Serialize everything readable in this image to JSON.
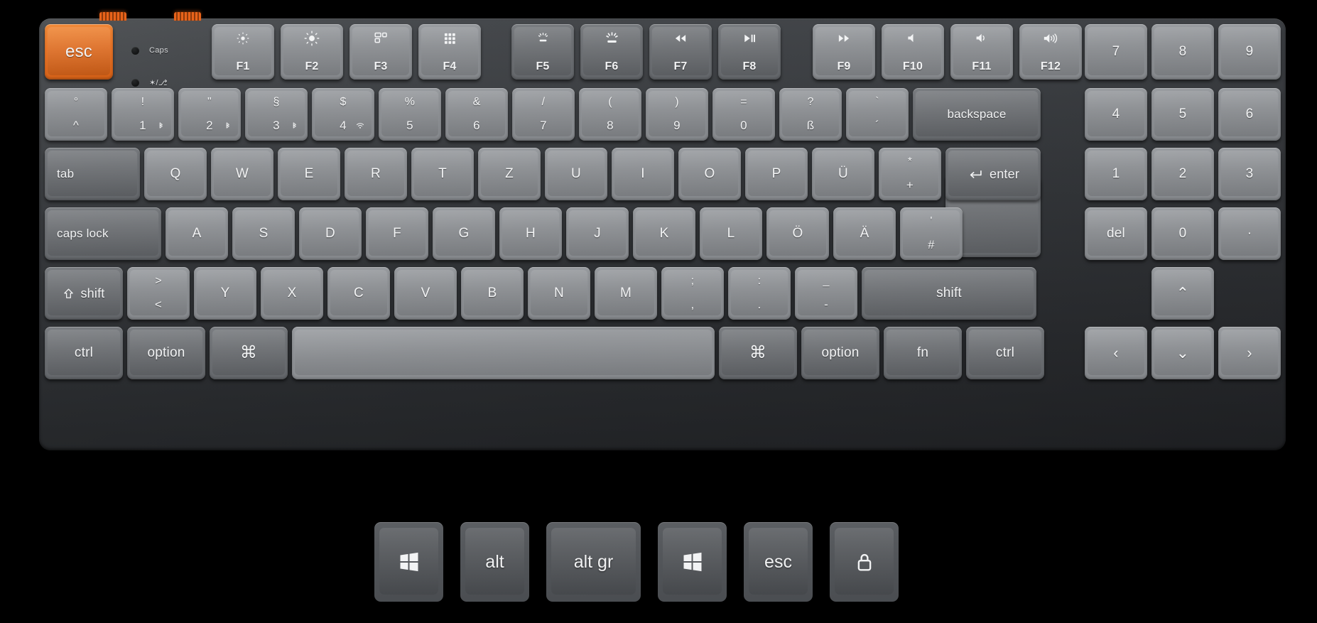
{
  "device": {
    "name": "keychron-low-profile-keyboard",
    "layout": "german-qwertz",
    "accent_color": "#e87428",
    "body_color": "#3d4044",
    "key_color_light": "#8e9195",
    "key_color_dark": "#6e7175",
    "legend_color": "#f2f3f4"
  },
  "indicators": [
    {
      "id": "caps-lock-indicator",
      "label": "Caps"
    },
    {
      "id": "bluetooth-wifi-indicator",
      "label": "✶/⎇"
    }
  ],
  "rows": {
    "function_row": [
      {
        "name": "escape",
        "label": "esc",
        "icon": "",
        "style": "esc"
      },
      {
        "name": "f1",
        "label": "F1",
        "icon": "brightness-down",
        "style": "light"
      },
      {
        "name": "f2",
        "label": "F2",
        "icon": "brightness-up",
        "style": "light"
      },
      {
        "name": "f3",
        "label": "F3",
        "icon": "mission-control",
        "style": "light"
      },
      {
        "name": "f4",
        "label": "F4",
        "icon": "launchpad",
        "style": "light"
      },
      {
        "name": "f5",
        "label": "F5",
        "icon": "backlight-down",
        "style": "dark"
      },
      {
        "name": "f6",
        "label": "F6",
        "icon": "backlight-up",
        "style": "dark"
      },
      {
        "name": "f7",
        "label": "F7",
        "icon": "rewind",
        "style": "dark"
      },
      {
        "name": "f8",
        "label": "F8",
        "icon": "play-pause",
        "style": "dark"
      },
      {
        "name": "f9",
        "label": "F9",
        "icon": "fast-forward",
        "style": "light"
      },
      {
        "name": "f10",
        "label": "F10",
        "icon": "mute",
        "style": "light"
      },
      {
        "name": "f11",
        "label": "F11",
        "icon": "volume-down",
        "style": "light"
      },
      {
        "name": "f12",
        "label": "F12",
        "icon": "volume-up",
        "style": "light"
      }
    ],
    "number_row": [
      {
        "name": "circumflex",
        "top": "°",
        "bottom": "^",
        "style": "light"
      },
      {
        "name": "digit-1",
        "top": "!",
        "bottom": "1",
        "style": "light",
        "badge": "bluetooth"
      },
      {
        "name": "digit-2",
        "top": "\"",
        "bottom": "2",
        "style": "light",
        "badge": "bluetooth"
      },
      {
        "name": "digit-3",
        "top": "§",
        "bottom": "3",
        "style": "light",
        "badge": "bluetooth"
      },
      {
        "name": "digit-4",
        "top": "$",
        "bottom": "4",
        "style": "light",
        "badge": "wifi"
      },
      {
        "name": "digit-5",
        "top": "%",
        "bottom": "5",
        "style": "light"
      },
      {
        "name": "digit-6",
        "top": "&",
        "bottom": "6",
        "style": "light"
      },
      {
        "name": "digit-7",
        "top": "/",
        "bottom": "7",
        "style": "light"
      },
      {
        "name": "digit-8",
        "top": "(",
        "bottom": "8",
        "style": "light"
      },
      {
        "name": "digit-9",
        "top": ")",
        "bottom": "9",
        "style": "light"
      },
      {
        "name": "digit-0",
        "top": "=",
        "bottom": "0",
        "style": "light"
      },
      {
        "name": "eszett",
        "top": "?",
        "bottom": "ß",
        "style": "light"
      },
      {
        "name": "acute",
        "top": "`",
        "bottom": "´",
        "style": "light"
      },
      {
        "name": "backspace",
        "label": "backspace",
        "style": "dark"
      }
    ],
    "top_row": [
      {
        "name": "tab",
        "label": "tab",
        "style": "dark",
        "align": "left"
      },
      {
        "name": "key-q",
        "label": "Q",
        "style": "light"
      },
      {
        "name": "key-w",
        "label": "W",
        "style": "light"
      },
      {
        "name": "key-e",
        "label": "E",
        "style": "light"
      },
      {
        "name": "key-r",
        "label": "R",
        "style": "light"
      },
      {
        "name": "key-t",
        "label": "T",
        "style": "light"
      },
      {
        "name": "key-z",
        "label": "Z",
        "style": "light"
      },
      {
        "name": "key-u",
        "label": "U",
        "style": "light"
      },
      {
        "name": "key-i",
        "label": "I",
        "style": "light"
      },
      {
        "name": "key-o",
        "label": "O",
        "style": "light"
      },
      {
        "name": "key-p",
        "label": "P",
        "style": "light"
      },
      {
        "name": "key-uuml",
        "label": "Ü",
        "style": "light"
      },
      {
        "name": "plus",
        "top": "*",
        "bottom": "+",
        "style": "light"
      },
      {
        "name": "enter",
        "label": "enter",
        "icon": "enter-arrow",
        "style": "dark"
      }
    ],
    "home_row": [
      {
        "name": "caps-lock",
        "label": "caps lock",
        "style": "dark",
        "align": "left"
      },
      {
        "name": "key-a",
        "label": "A",
        "style": "light"
      },
      {
        "name": "key-s",
        "label": "S",
        "style": "light"
      },
      {
        "name": "key-d",
        "label": "D",
        "style": "light"
      },
      {
        "name": "key-f",
        "label": "F",
        "style": "light"
      },
      {
        "name": "key-g",
        "label": "G",
        "style": "light"
      },
      {
        "name": "key-h",
        "label": "H",
        "style": "light"
      },
      {
        "name": "key-j",
        "label": "J",
        "style": "light"
      },
      {
        "name": "key-k",
        "label": "K",
        "style": "light"
      },
      {
        "name": "key-l",
        "label": "L",
        "style": "light"
      },
      {
        "name": "key-ouml",
        "label": "Ö",
        "style": "light"
      },
      {
        "name": "key-auml",
        "label": "Ä",
        "style": "light"
      },
      {
        "name": "hash",
        "top": "'",
        "bottom": "#",
        "style": "light"
      }
    ],
    "bottom_letter_row": [
      {
        "name": "left-shift",
        "label": "shift",
        "icon": "shift-arrow",
        "style": "dark"
      },
      {
        "name": "less-than",
        "top": ">",
        "bottom": "<",
        "style": "light"
      },
      {
        "name": "key-y",
        "label": "Y",
        "style": "light"
      },
      {
        "name": "key-x",
        "label": "X",
        "style": "light"
      },
      {
        "name": "key-c",
        "label": "C",
        "style": "light"
      },
      {
        "name": "key-v",
        "label": "V",
        "style": "light"
      },
      {
        "name": "key-b",
        "label": "B",
        "style": "light"
      },
      {
        "name": "key-n",
        "label": "N",
        "style": "light"
      },
      {
        "name": "key-m",
        "label": "M",
        "style": "light"
      },
      {
        "name": "semicolon",
        "top": ";",
        "bottom": ",",
        "style": "light"
      },
      {
        "name": "colon",
        "top": ":",
        "bottom": ".",
        "style": "light"
      },
      {
        "name": "dash",
        "top": "_",
        "bottom": "-",
        "style": "light"
      },
      {
        "name": "right-shift",
        "label": "shift",
        "style": "dark"
      }
    ],
    "modifier_row": [
      {
        "name": "left-ctrl",
        "label": "ctrl",
        "style": "dark"
      },
      {
        "name": "left-option",
        "label": "option",
        "style": "dark"
      },
      {
        "name": "left-command",
        "label": "⌘",
        "style": "dark"
      },
      {
        "name": "spacebar",
        "label": "",
        "style": "light"
      },
      {
        "name": "right-command",
        "label": "⌘",
        "style": "dark"
      },
      {
        "name": "right-option",
        "label": "option",
        "style": "dark"
      },
      {
        "name": "fn",
        "label": "fn",
        "style": "dark"
      },
      {
        "name": "right-ctrl",
        "label": "ctrl",
        "style": "dark"
      }
    ],
    "numpad": [
      {
        "name": "numpad-7",
        "label": "7",
        "style": "light"
      },
      {
        "name": "numpad-8",
        "label": "8",
        "style": "light"
      },
      {
        "name": "numpad-9",
        "label": "9",
        "style": "light"
      },
      {
        "name": "numpad-4",
        "label": "4",
        "style": "light"
      },
      {
        "name": "numpad-5",
        "label": "5",
        "style": "light"
      },
      {
        "name": "numpad-6",
        "label": "6",
        "style": "light"
      },
      {
        "name": "numpad-1",
        "label": "1",
        "style": "light"
      },
      {
        "name": "numpad-2",
        "label": "2",
        "style": "light"
      },
      {
        "name": "numpad-3",
        "label": "3",
        "style": "light"
      },
      {
        "name": "numpad-del",
        "label": "del",
        "style": "light"
      },
      {
        "name": "numpad-0",
        "label": "0",
        "style": "light"
      },
      {
        "name": "numpad-dot",
        "label": "·",
        "style": "light"
      }
    ],
    "arrows": [
      {
        "name": "arrow-up",
        "label": "⌃",
        "style": "light"
      },
      {
        "name": "arrow-left",
        "label": "‹",
        "style": "light"
      },
      {
        "name": "arrow-down",
        "label": "⌄",
        "style": "light"
      },
      {
        "name": "arrow-right",
        "label": "›",
        "style": "light"
      }
    ]
  },
  "extra_keycaps": [
    {
      "name": "windows-keycap-left",
      "label": "",
      "icon": "windows-logo",
      "wide": false
    },
    {
      "name": "alt-keycap",
      "label": "alt",
      "icon": "",
      "wide": false
    },
    {
      "name": "altgr-keycap",
      "label": "alt  gr",
      "icon": "",
      "wide": true
    },
    {
      "name": "windows-keycap-right",
      "label": "",
      "icon": "windows-logo",
      "wide": false
    },
    {
      "name": "esc-keycap",
      "label": "esc",
      "icon": "",
      "wide": false
    },
    {
      "name": "lock-keycap",
      "label": "",
      "icon": "lock",
      "wide": false
    }
  ]
}
